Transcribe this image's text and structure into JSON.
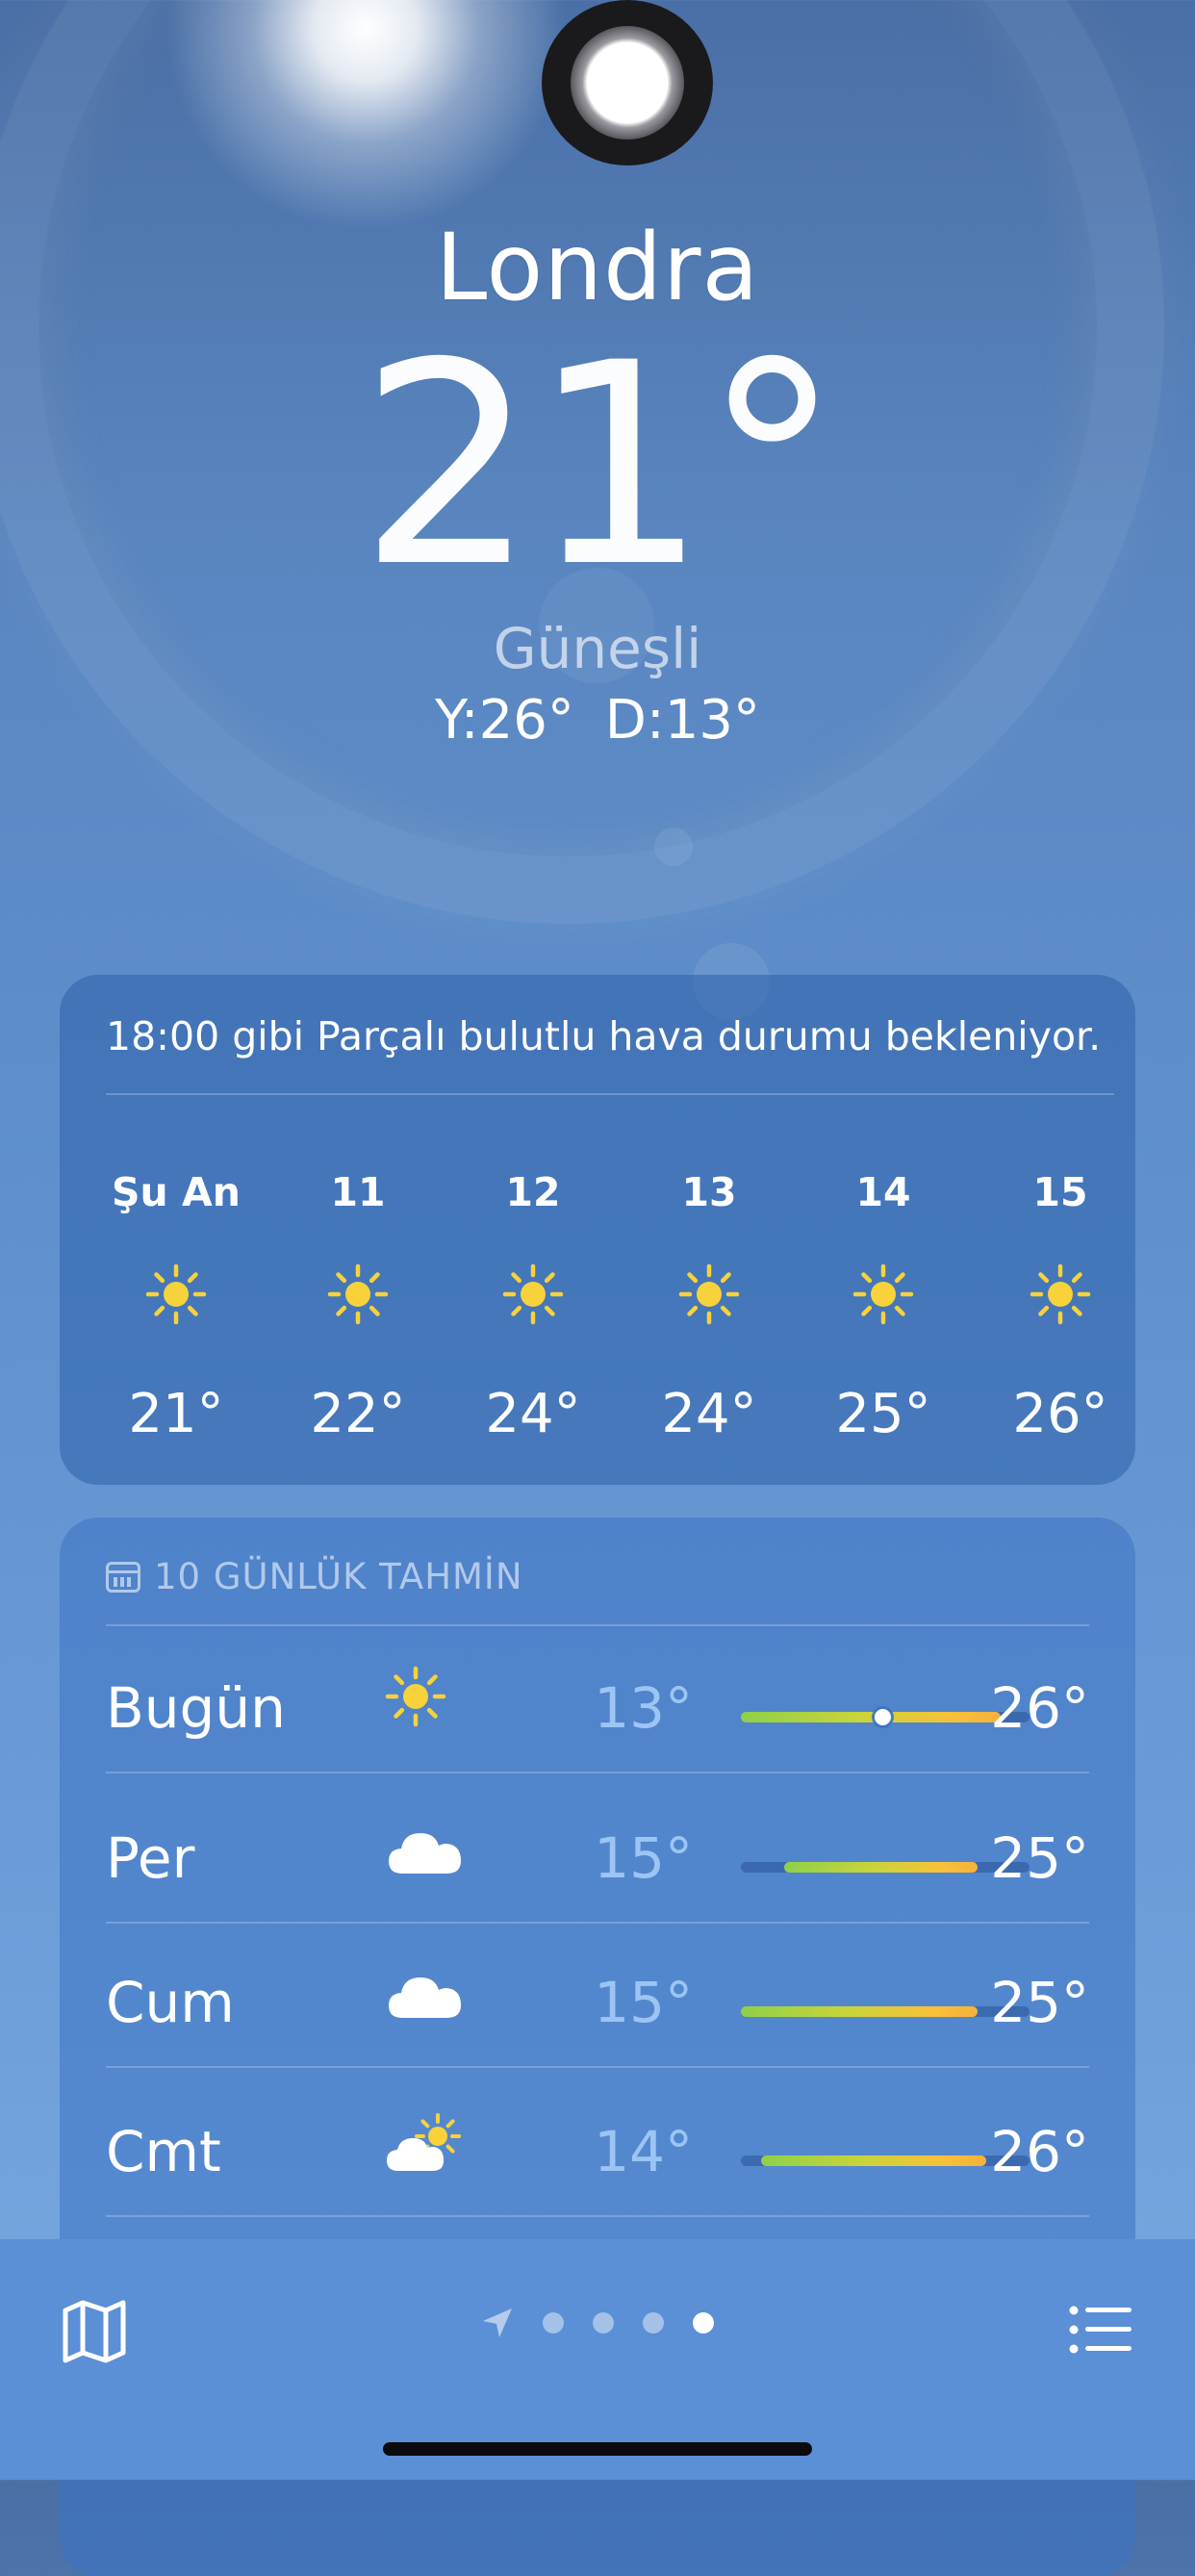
{
  "location": {
    "city": "Londra",
    "temperature": "21",
    "degree": "°",
    "condition": "Güneşli",
    "high_low": "Y:26°  D:13°"
  },
  "hourly": {
    "summary": "18:00 gibi Parçalı bulutlu hava durumu bekleniyor.",
    "hours": [
      {
        "label": "Şu An",
        "icon": "sun-icon",
        "temp": "21°"
      },
      {
        "label": "11",
        "icon": "sun-icon",
        "temp": "22°"
      },
      {
        "label": "12",
        "icon": "sun-icon",
        "temp": "24°"
      },
      {
        "label": "13",
        "icon": "sun-icon",
        "temp": "24°"
      },
      {
        "label": "14",
        "icon": "sun-icon",
        "temp": "25°"
      },
      {
        "label": "15",
        "icon": "sun-icon",
        "temp": "26°"
      }
    ]
  },
  "daily": {
    "title": "10 GÜNLÜK TAHMİN",
    "days": [
      {
        "day": "Bugün",
        "icon": "sun-icon",
        "low": "13°",
        "high": "26°",
        "range": [
          0.0,
          0.9
        ],
        "current": 0.49
      },
      {
        "day": "Per",
        "icon": "cloud-icon",
        "low": "15°",
        "high": "25°",
        "range": [
          0.15,
          0.82
        ]
      },
      {
        "day": "Cum",
        "icon": "cloud-icon",
        "low": "15°",
        "high": "25°",
        "range": [
          0.0,
          0.82
        ]
      },
      {
        "day": "Cmt",
        "icon": "partly-sunny-icon",
        "low": "14°",
        "high": "26°",
        "range": [
          0.07,
          0.85
        ]
      }
    ]
  },
  "bottom_bar": {
    "map_icon": "map-icon",
    "list_icon": "list-icon",
    "pages": 4,
    "active_page": 3
  },
  "colors": {
    "sun": "#f7d23a",
    "low_temp": "#a0c8f5",
    "bar_gradient": [
      "#8fd04a",
      "#f6b13b"
    ]
  }
}
